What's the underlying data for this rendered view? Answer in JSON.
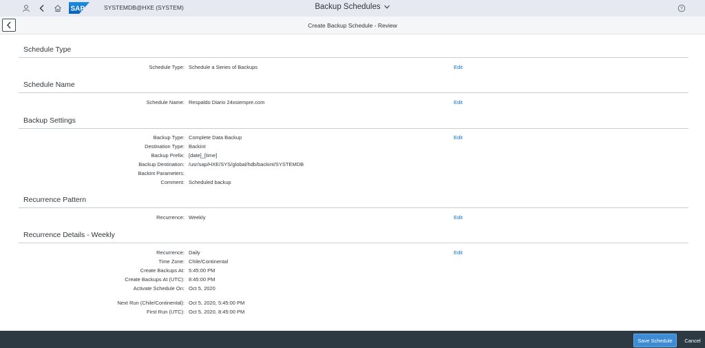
{
  "shell": {
    "system_label": "SYSTEMDB@HXE (SYSTEM)",
    "app_title": "Backup Schedules",
    "logo_text": "SAP",
    "icons": [
      "user-icon",
      "back-chevron-icon",
      "home-icon",
      "chevron-down-icon",
      "help-icon"
    ]
  },
  "subheader": {
    "title": "Create Backup Schedule - Review"
  },
  "edit_label": "Edit",
  "sections": {
    "schedule_type": {
      "title": "Schedule Type",
      "fields": [
        {
          "label": "Schedule Type:",
          "value": "Schedule a Series of Backups"
        }
      ]
    },
    "schedule_name": {
      "title": "Schedule Name",
      "fields": [
        {
          "label": "Schedule Name:",
          "value": "Respaldo Diario 24xsiempre.com"
        }
      ]
    },
    "backup_settings": {
      "title": "Backup Settings",
      "fields": [
        {
          "label": "Backup Type:",
          "value": "Complete Data Backup"
        },
        {
          "label": "Destination Type:",
          "value": "Backint"
        },
        {
          "label": "Backup Prefix:",
          "value": "[date]_[time]"
        },
        {
          "label": "Backup Destination:",
          "value": "/usr/sap/HXE/SYS/global/hdb/backint/SYSTEMDB"
        },
        {
          "label": "Backint Parameters:",
          "value": ""
        },
        {
          "label": "Comment:",
          "value": "Scheduled backup"
        }
      ]
    },
    "recurrence_pattern": {
      "title": "Recurrence Pattern",
      "fields": [
        {
          "label": "Recurrence:",
          "value": "Weekly"
        }
      ]
    },
    "recurrence_details": {
      "title": "Recurrence Details - Weekly",
      "fields": [
        {
          "label": "Recurrence:",
          "value": "Daily"
        },
        {
          "label": "Time Zone:",
          "value": "Chile/Continental"
        },
        {
          "label": "Create Backups At:",
          "value": "5:45:00 PM"
        },
        {
          "label": "Create Backups At (UTC):",
          "value": "8:45:00 PM"
        },
        {
          "label": "Activate Schedule On:",
          "value": "Oct 5, 2020"
        },
        {
          "label": "Next Run (Chile/Continental):",
          "value": "Oct 5, 2020, 5:45:00 PM"
        },
        {
          "label": "First Run (UTC):",
          "value": "Oct 5, 2020, 8:45:00 PM"
        }
      ]
    }
  },
  "footer": {
    "save_label": "Save Schedule",
    "cancel_label": "Cancel"
  },
  "colors": {
    "shell_bg": "#e6e9f2",
    "footer_bg": "#2d3a44",
    "primary_button": "#3e8cd6",
    "link": "#0a6ed1",
    "sap_logo_blue": "#0a6ed1"
  }
}
